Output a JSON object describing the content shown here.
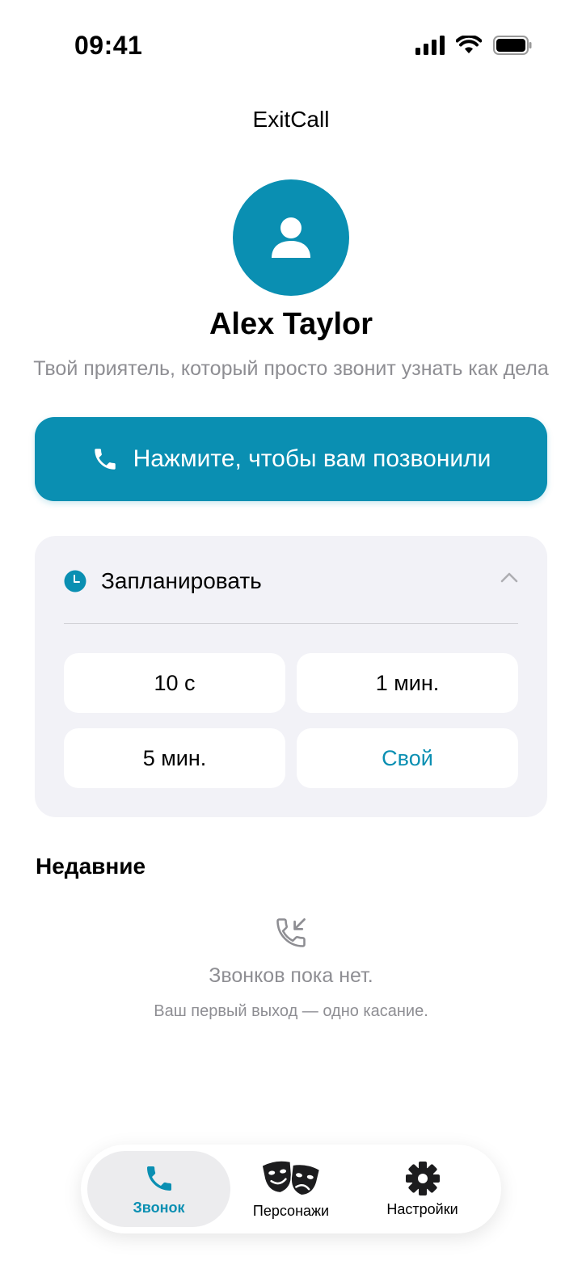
{
  "status_bar": {
    "time": "09:41"
  },
  "app": {
    "title": "ExitCall"
  },
  "contact": {
    "name": "Alex Taylor",
    "description": "Твой приятель, который просто звонит узнать как дела"
  },
  "call_button": {
    "label": "Нажмите, чтобы вам позвонили"
  },
  "schedule": {
    "title": "Запланировать",
    "options": [
      "10 с",
      "1 мин.",
      "5 мин.",
      "Свой"
    ]
  },
  "recent": {
    "title": "Недавние",
    "empty_title": "Звонков пока нет.",
    "empty_subtitle": "Ваш первый выход — одно касание."
  },
  "tabs": [
    {
      "label": "Звонок",
      "active": true
    },
    {
      "label": "Персонажи",
      "active": false
    },
    {
      "label": "Настройки",
      "active": false
    }
  ],
  "colors": {
    "accent": "#0a8fb2",
    "card_bg": "#f2f2f7",
    "secondary_text": "#8e8e93"
  },
  "icons": [
    "phone-icon",
    "clock-icon",
    "chevron-up-icon",
    "incoming-call-icon",
    "theater-masks-icon",
    "gear-icon",
    "person-icon"
  ]
}
